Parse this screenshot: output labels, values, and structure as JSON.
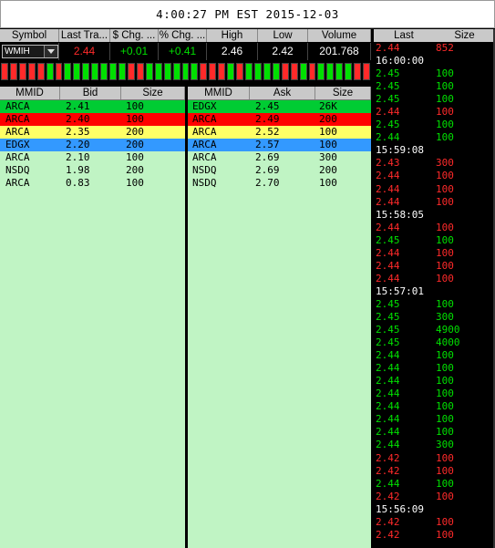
{
  "header": {
    "clock": "4:00:27 PM EST 2015-12-03"
  },
  "colors": {
    "up": "#00e000",
    "down": "#ff2a2a",
    "level1": "#00cc33",
    "level2": "#ff0000",
    "level3": "#ffff66",
    "level4": "#3399ff",
    "book_bg": "#c0f4c4"
  },
  "quote": {
    "headers": [
      "Symbol",
      "Last Tra...",
      "$ Chg. ...",
      "% Chg. ...",
      "High",
      "Low",
      "Volume"
    ],
    "symbol": "WMIH",
    "last_trade": "2.44",
    "dollar_change": "+0.01",
    "percent_change": "+0.41",
    "high": "2.46",
    "low": "2.42",
    "volume": "201.768"
  },
  "tick_bars": [
    "down",
    "down",
    "down",
    "down",
    "down",
    "up",
    "down",
    "up",
    "up",
    "up",
    "up",
    "up",
    "up",
    "up",
    "down",
    "down",
    "up",
    "up",
    "up",
    "up",
    "up",
    "up",
    "down",
    "down",
    "down",
    "up",
    "down",
    "up",
    "up",
    "up",
    "up",
    "down",
    "down",
    "up",
    "down",
    "up",
    "up",
    "up",
    "up",
    "down",
    "down"
  ],
  "bid_book": {
    "headers": [
      "MMID",
      "Bid",
      "Size"
    ],
    "rows": [
      {
        "mmid": "ARCA",
        "price": "2.41",
        "size": "100",
        "level": 1
      },
      {
        "mmid": "ARCA",
        "price": "2.40",
        "size": "100",
        "level": 2
      },
      {
        "mmid": "ARCA",
        "price": "2.35",
        "size": "200",
        "level": 3
      },
      {
        "mmid": "EDGX",
        "price": "2.20",
        "size": "200",
        "level": 4
      },
      {
        "mmid": "ARCA",
        "price": "2.10",
        "size": "100",
        "level": 0
      },
      {
        "mmid": "NSDQ",
        "price": "1.98",
        "size": "200",
        "level": 0
      },
      {
        "mmid": "ARCA",
        "price": "0.83",
        "size": "100",
        "level": 0
      }
    ]
  },
  "ask_book": {
    "headers": [
      "MMID",
      "Ask",
      "Size"
    ],
    "rows": [
      {
        "mmid": "EDGX",
        "price": "2.45",
        "size": "26K",
        "level": 1
      },
      {
        "mmid": "ARCA",
        "price": "2.49",
        "size": "200",
        "level": 2
      },
      {
        "mmid": "ARCA",
        "price": "2.52",
        "size": "100",
        "level": 3
      },
      {
        "mmid": "ARCA",
        "price": "2.57",
        "size": "100",
        "level": 4
      },
      {
        "mmid": "ARCA",
        "price": "2.69",
        "size": "300",
        "level": 0
      },
      {
        "mmid": "NSDQ",
        "price": "2.69",
        "size": "200",
        "level": 0
      },
      {
        "mmid": "NSDQ",
        "price": "2.70",
        "size": "100",
        "level": 0
      }
    ]
  },
  "time_and_sales": {
    "headers": [
      "Last",
      "Size"
    ],
    "rows": [
      {
        "price": "2.44",
        "size": "852",
        "dir": "down"
      },
      {
        "time": "16:00:00"
      },
      {
        "price": "2.45",
        "size": "100",
        "dir": "up"
      },
      {
        "price": "2.45",
        "size": "100",
        "dir": "up"
      },
      {
        "price": "2.45",
        "size": "100",
        "dir": "up"
      },
      {
        "price": "2.44",
        "size": "100",
        "dir": "down"
      },
      {
        "price": "2.45",
        "size": "100",
        "dir": "up"
      },
      {
        "price": "2.44",
        "size": "100",
        "dir": "up"
      },
      {
        "time": "15:59:08"
      },
      {
        "price": "2.43",
        "size": "300",
        "dir": "down"
      },
      {
        "price": "2.44",
        "size": "100",
        "dir": "down"
      },
      {
        "price": "2.44",
        "size": "100",
        "dir": "down"
      },
      {
        "price": "2.44",
        "size": "100",
        "dir": "down"
      },
      {
        "time": "15:58:05"
      },
      {
        "price": "2.44",
        "size": "100",
        "dir": "down"
      },
      {
        "price": "2.45",
        "size": "100",
        "dir": "up"
      },
      {
        "price": "2.44",
        "size": "100",
        "dir": "down"
      },
      {
        "price": "2.44",
        "size": "100",
        "dir": "down"
      },
      {
        "price": "2.44",
        "size": "100",
        "dir": "down"
      },
      {
        "time": "15:57:01"
      },
      {
        "price": "2.45",
        "size": "100",
        "dir": "up"
      },
      {
        "price": "2.45",
        "size": "300",
        "dir": "up"
      },
      {
        "price": "2.45",
        "size": "4900",
        "dir": "up"
      },
      {
        "price": "2.45",
        "size": "4000",
        "dir": "up"
      },
      {
        "price": "2.44",
        "size": "100",
        "dir": "up"
      },
      {
        "price": "2.44",
        "size": "100",
        "dir": "up"
      },
      {
        "price": "2.44",
        "size": "100",
        "dir": "up"
      },
      {
        "price": "2.44",
        "size": "100",
        "dir": "up"
      },
      {
        "price": "2.44",
        "size": "100",
        "dir": "up"
      },
      {
        "price": "2.44",
        "size": "100",
        "dir": "up"
      },
      {
        "price": "2.44",
        "size": "100",
        "dir": "up"
      },
      {
        "price": "2.44",
        "size": "300",
        "dir": "up"
      },
      {
        "price": "2.42",
        "size": "100",
        "dir": "down"
      },
      {
        "price": "2.42",
        "size": "100",
        "dir": "down"
      },
      {
        "price": "2.44",
        "size": "100",
        "dir": "up"
      },
      {
        "price": "2.42",
        "size": "100",
        "dir": "down"
      },
      {
        "time": "15:56:09"
      },
      {
        "price": "2.42",
        "size": "100",
        "dir": "down"
      },
      {
        "price": "2.42",
        "size": "100",
        "dir": "down"
      }
    ]
  }
}
